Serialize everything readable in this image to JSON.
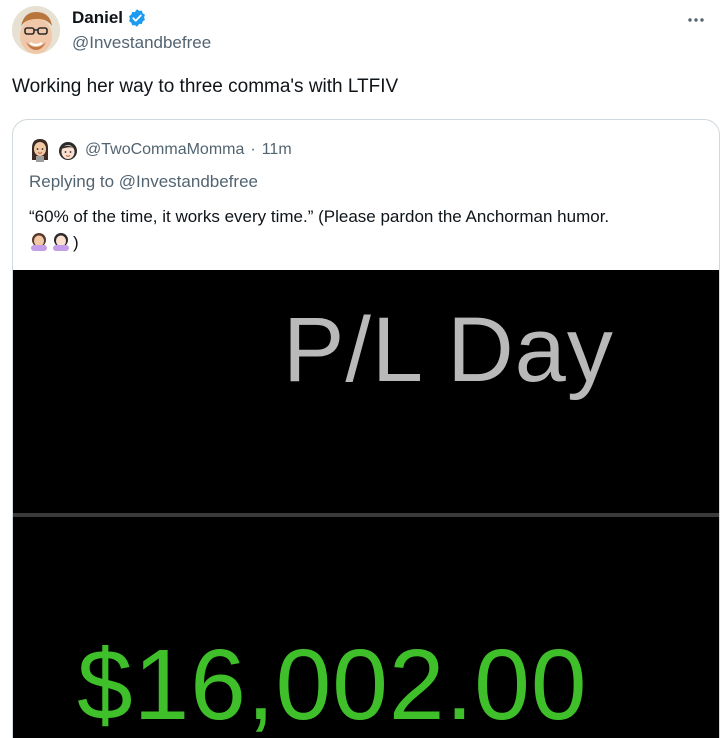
{
  "author": {
    "name": "Daniel",
    "handle": "@Investandbefree",
    "verified_icon": "verified-badge-icon",
    "avatar_icon": "avatar"
  },
  "tweet": {
    "text": "Working her way to three comma's with LTFIV"
  },
  "more_icon": "more-options-icon",
  "quote": {
    "handle": "@TwoCommaMomma",
    "dot": "·",
    "time": "11m",
    "replying_prefix": "Replying to",
    "replying_handle": "@Investandbefree",
    "text": "“60% of the time, it works every time.” (Please pardon the Anchorman humor.",
    "text_end": ")",
    "emojis": [
      "woman-facepalming-emoji",
      "woman-facepalming-emoji"
    ],
    "image": {
      "label": "P/L Day",
      "value": "$16,002.00"
    }
  },
  "colors": {
    "brand_blue": "#1d9bf0",
    "gain_green": "#3fbf2a",
    "secondary_text": "#536471"
  }
}
